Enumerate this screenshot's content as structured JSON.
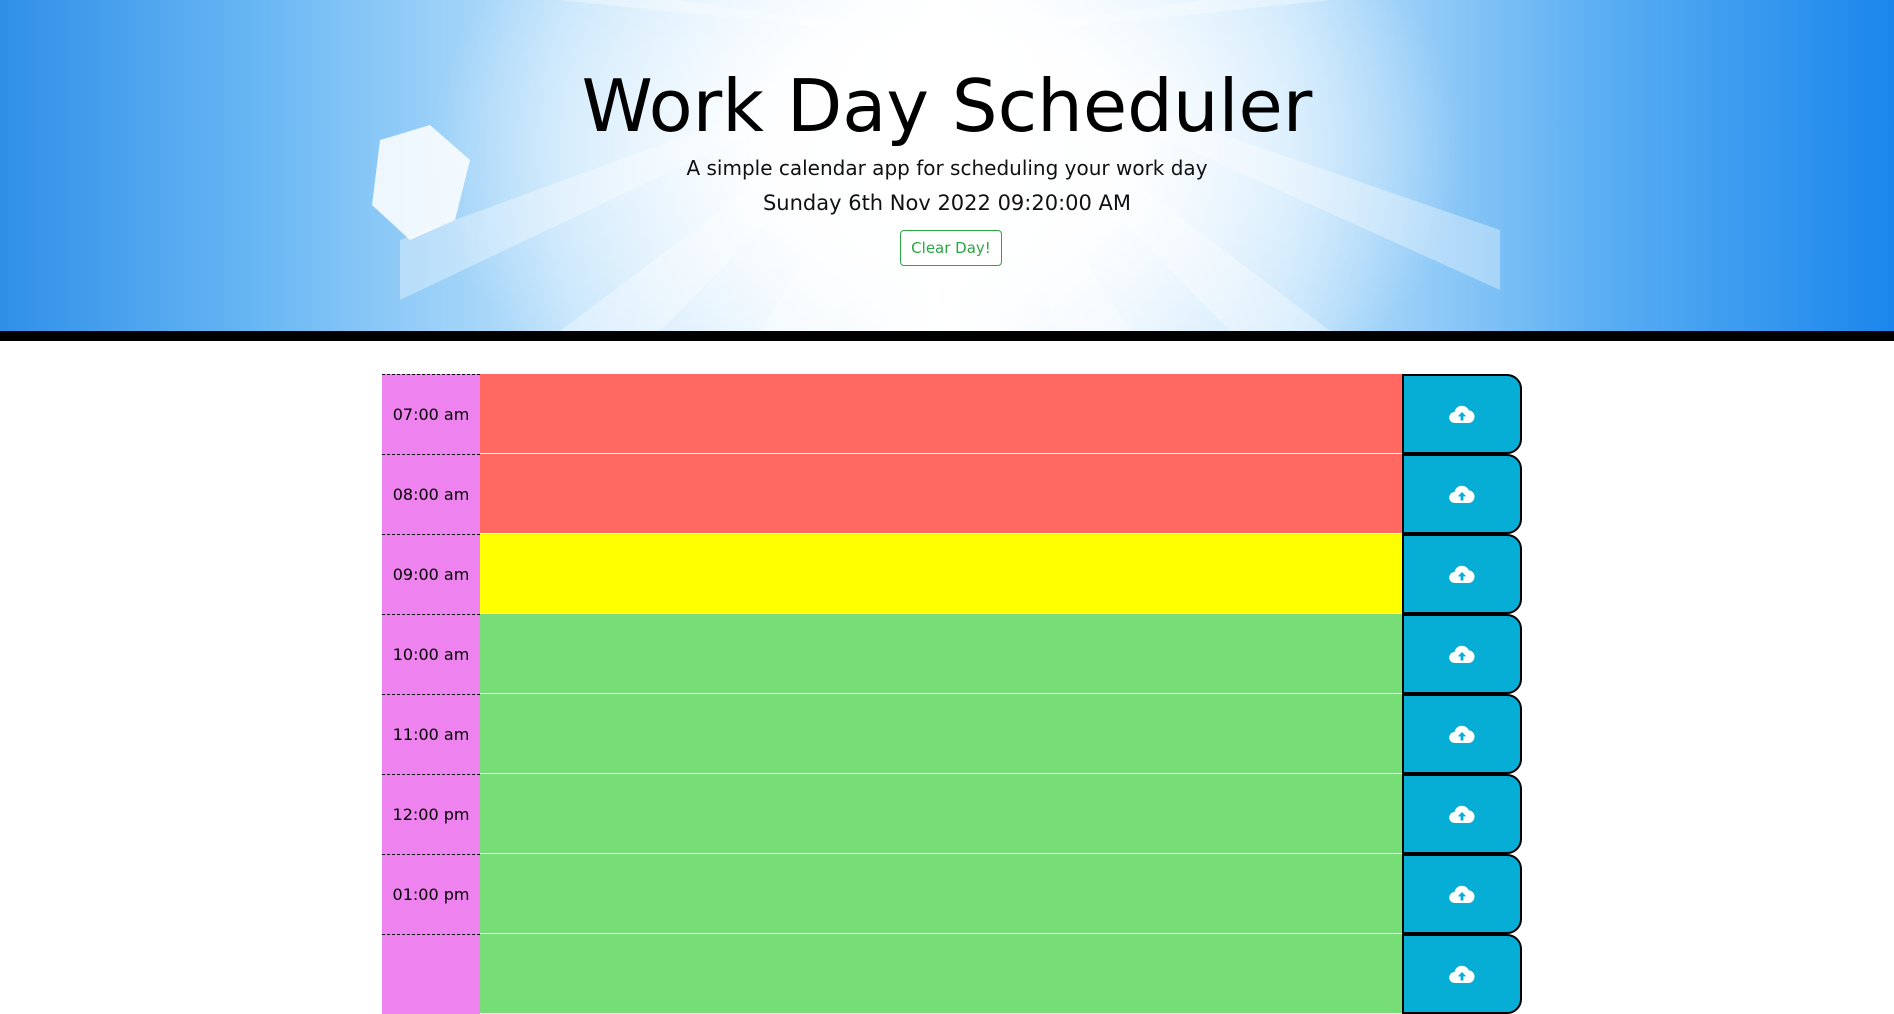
{
  "header": {
    "title": "Work Day Scheduler",
    "subtitle": "A simple calendar app for scheduling your work day",
    "current_date": "Sunday 6th Nov 2022 09:20:00 AM",
    "clear_button_label": "Clear Day!"
  },
  "colors": {
    "hour_background": "#ee82ee",
    "past": "#ff6961",
    "present": "#ffff00",
    "future": "#77dd77",
    "save_button": "#06aed5",
    "clear_button": "#28a745"
  },
  "schedule": {
    "save_icon": "cloud-upload-icon",
    "rows": [
      {
        "hour": "07:00 am",
        "status": "past",
        "text": ""
      },
      {
        "hour": "08:00 am",
        "status": "past",
        "text": ""
      },
      {
        "hour": "09:00 am",
        "status": "present",
        "text": ""
      },
      {
        "hour": "10:00 am",
        "status": "future",
        "text": ""
      },
      {
        "hour": "11:00 am",
        "status": "future",
        "text": ""
      },
      {
        "hour": "12:00 pm",
        "status": "future",
        "text": ""
      },
      {
        "hour": "01:00 pm",
        "status": "future",
        "text": ""
      },
      {
        "hour": "",
        "status": "future",
        "text": ""
      }
    ]
  }
}
